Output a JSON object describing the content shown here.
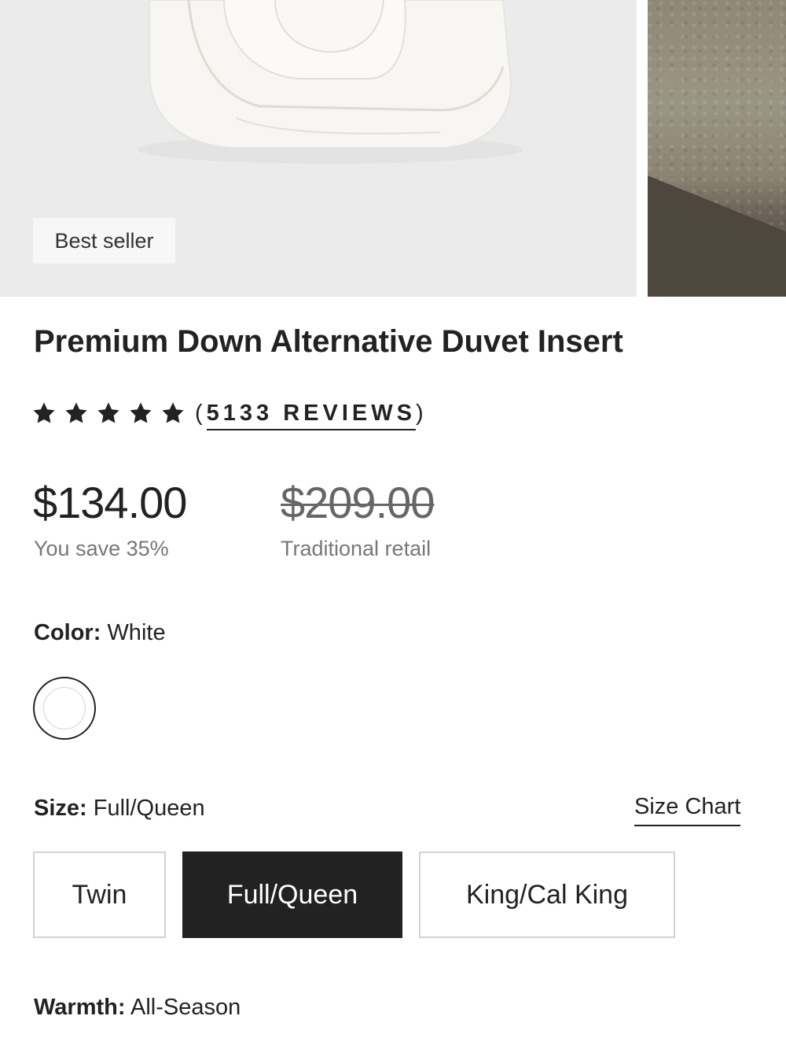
{
  "gallery": {
    "badge": "Best seller"
  },
  "product": {
    "title": "Premium Down Alternative Duvet Insert",
    "rating_stars": 5,
    "reviews_count": "5133 REVIEWS",
    "reviews_open": "(",
    "reviews_close": ")"
  },
  "pricing": {
    "price": "$134.00",
    "savings": "You save 35%",
    "retail_price": "$209.00",
    "retail_label": "Traditional retail"
  },
  "color": {
    "label": "Color:",
    "value": "White",
    "swatch_color": "#ffffff"
  },
  "size": {
    "label": "Size:",
    "value": "Full/Queen",
    "chart_link": "Size Chart",
    "options": [
      "Twin",
      "Full/Queen",
      "King/Cal King"
    ]
  },
  "warmth": {
    "label": "Warmth:",
    "value": "All-Season"
  },
  "colors": {
    "text": "#222222",
    "muted": "#777777",
    "selected_bg": "#222222",
    "image_bg": "#ebebeb"
  }
}
